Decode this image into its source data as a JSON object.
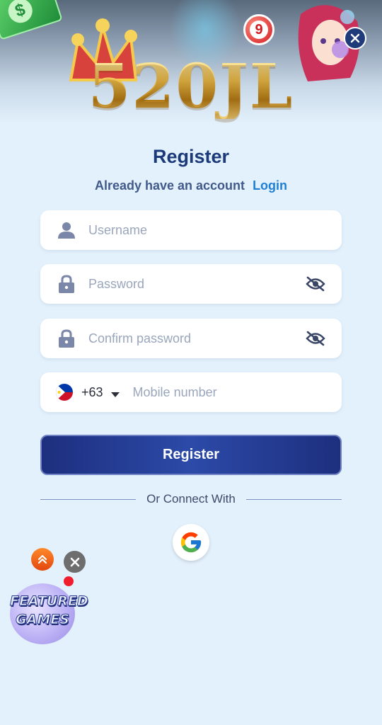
{
  "brand": {
    "logo_text": "520JL"
  },
  "form": {
    "title": "Register",
    "already_text": "Already have an account",
    "login_link": "Login",
    "username_placeholder": "Username",
    "password_placeholder": "Password",
    "confirm_placeholder": "Confirm password",
    "country_code": "+63",
    "mobile_placeholder": "Mobile number",
    "register_button": "Register",
    "divider_text": "Or Connect With"
  },
  "banner": {
    "ball_number": "9",
    "money_symbol": "$"
  },
  "floating": {
    "featured_line1": "FEATURED",
    "featured_line2": "GAMES"
  },
  "colors": {
    "primary": "#1c3a7a",
    "link": "#1e7fd6",
    "background": "#e3f1fc"
  },
  "icons": [
    "close-icon",
    "user-icon",
    "lock-icon",
    "eye-off-icon",
    "ph-flag-icon",
    "caret-down-icon",
    "google-icon",
    "chevron-up-icon"
  ]
}
